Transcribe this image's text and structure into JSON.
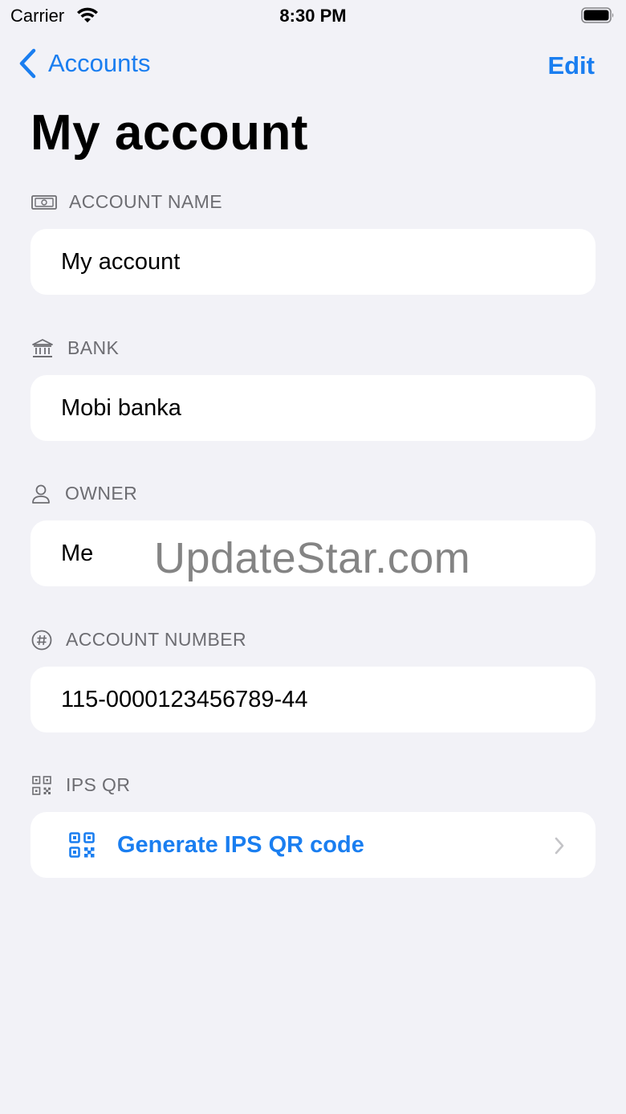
{
  "status_bar": {
    "carrier": "Carrier",
    "time": "8:30 PM"
  },
  "nav": {
    "back_label": "Accounts",
    "edit_label": "Edit"
  },
  "page_title": "My account",
  "sections": {
    "account_name": {
      "header": "ACCOUNT NAME",
      "icon": "banknote-icon",
      "value": "My account"
    },
    "bank": {
      "header": "BANK",
      "icon": "bank-building-icon",
      "value": "Mobi banka"
    },
    "owner": {
      "header": "OWNER",
      "icon": "person-icon",
      "value": "Me"
    },
    "account_number": {
      "header": "ACCOUNT NUMBER",
      "icon": "number-sign-icon",
      "value": "115-0000123456789-44"
    },
    "ips_qr": {
      "header": "IPS QR",
      "icon": "qr-code-icon",
      "action_label": "Generate IPS QR code"
    }
  },
  "watermark": "UpdateStar.com",
  "colors": {
    "accent": "#1a7ef0",
    "background": "#f2f2f7",
    "card": "#ffffff",
    "secondary_text": "#6d6d72"
  }
}
